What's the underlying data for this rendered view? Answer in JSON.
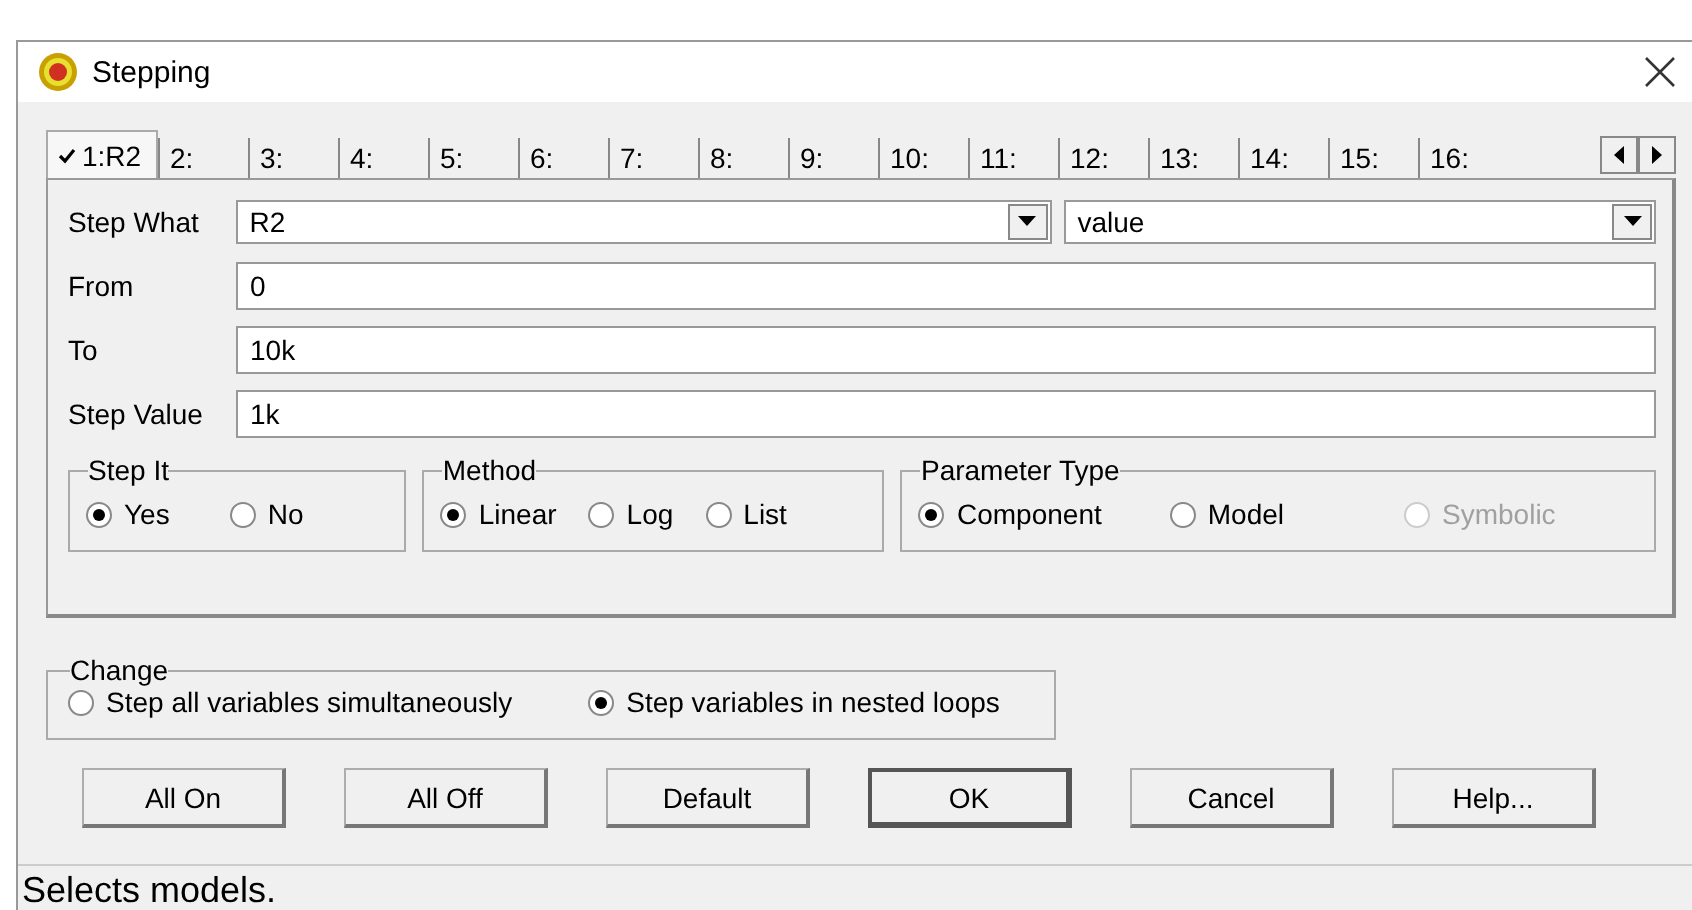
{
  "window": {
    "title": "Stepping"
  },
  "tabs": [
    {
      "label": "1:R2",
      "selected": true,
      "checked": true
    },
    {
      "label": "2:",
      "selected": false,
      "checked": false
    },
    {
      "label": "3:",
      "selected": false,
      "checked": false
    },
    {
      "label": "4:",
      "selected": false,
      "checked": false
    },
    {
      "label": "5:",
      "selected": false,
      "checked": false
    },
    {
      "label": "6:",
      "selected": false,
      "checked": false
    },
    {
      "label": "7:",
      "selected": false,
      "checked": false
    },
    {
      "label": "8:",
      "selected": false,
      "checked": false
    },
    {
      "label": "9:",
      "selected": false,
      "checked": false
    },
    {
      "label": "10:",
      "selected": false,
      "checked": false
    },
    {
      "label": "11:",
      "selected": false,
      "checked": false
    },
    {
      "label": "12:",
      "selected": false,
      "checked": false
    },
    {
      "label": "13:",
      "selected": false,
      "checked": false
    },
    {
      "label": "14:",
      "selected": false,
      "checked": false
    },
    {
      "label": "15:",
      "selected": false,
      "checked": false
    },
    {
      "label": "16:",
      "selected": false,
      "checked": false
    }
  ],
  "step_what": {
    "label": "Step What",
    "item": "R2",
    "property": "value"
  },
  "fields": [
    {
      "label": "From",
      "value": "0"
    },
    {
      "label": "To",
      "value": "10k"
    },
    {
      "label": "Step Value",
      "value": "1k"
    }
  ],
  "groups": [
    {
      "title": "Step It",
      "options": [
        {
          "label": "Yes",
          "selected": true,
          "disabled": false
        },
        {
          "label": "No",
          "selected": false,
          "disabled": false
        }
      ]
    },
    {
      "title": "Method",
      "options": [
        {
          "label": "Linear",
          "selected": true,
          "disabled": false
        },
        {
          "label": "Log",
          "selected": false,
          "disabled": false
        },
        {
          "label": "List",
          "selected": false,
          "disabled": false
        }
      ]
    },
    {
      "title": "Parameter Type",
      "options": [
        {
          "label": "Component",
          "selected": true,
          "disabled": false
        },
        {
          "label": "Model",
          "selected": false,
          "disabled": false
        },
        {
          "label": "Symbolic",
          "selected": false,
          "disabled": true
        }
      ]
    }
  ],
  "change": {
    "title": "Change",
    "options": [
      {
        "label": "Step all variables simultaneously",
        "selected": false
      },
      {
        "label": "Step variables in nested loops",
        "selected": true
      }
    ]
  },
  "buttons": [
    {
      "label": "All On",
      "default": false
    },
    {
      "label": "All Off",
      "default": false
    },
    {
      "label": "Default",
      "default": false
    },
    {
      "label": "OK",
      "default": true
    },
    {
      "label": "Cancel",
      "default": false
    },
    {
      "label": "Help...",
      "default": false
    }
  ],
  "status_bar": "Selects models."
}
